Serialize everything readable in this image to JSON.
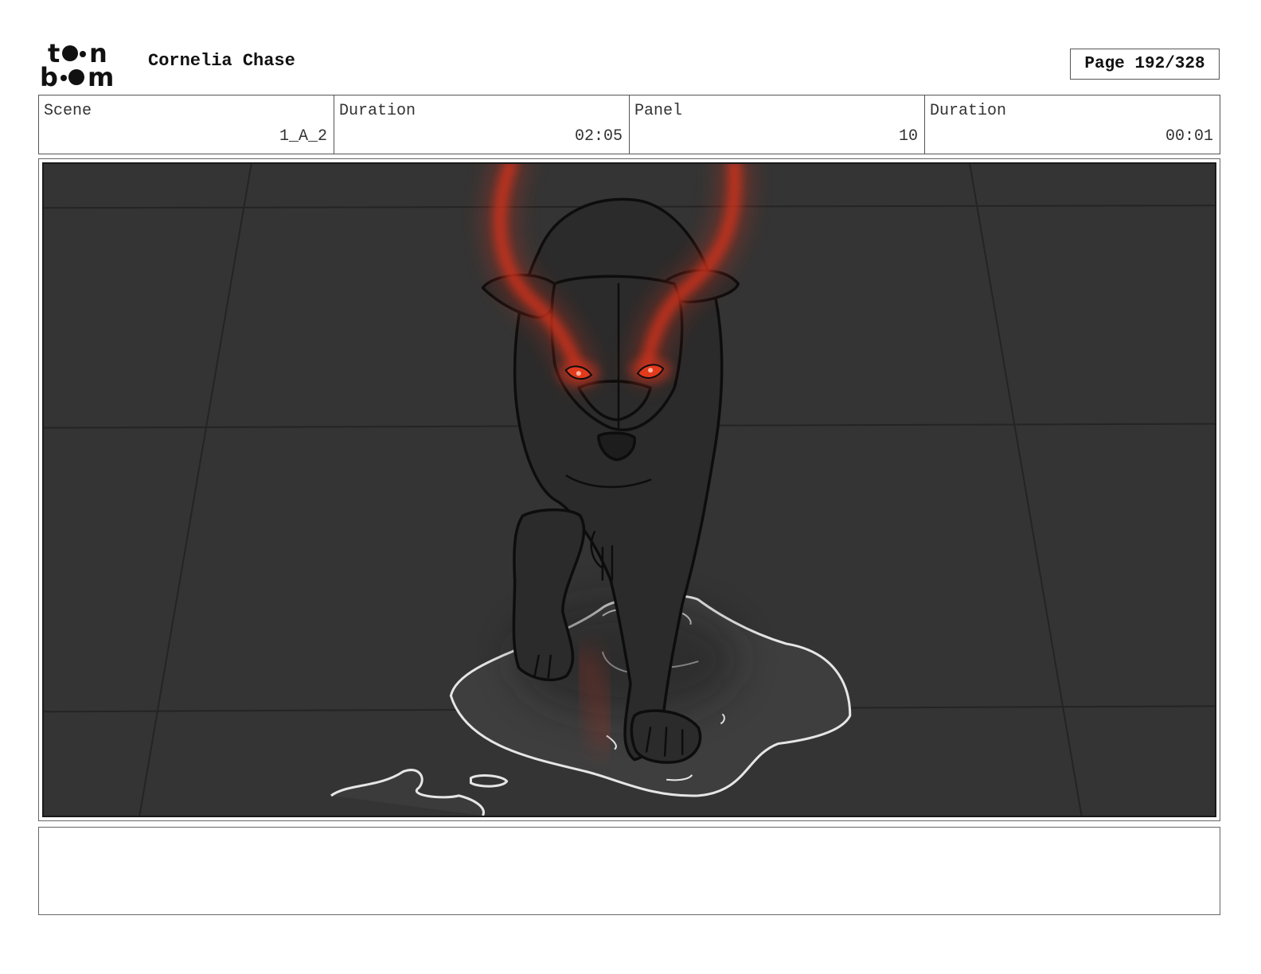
{
  "header": {
    "logo_text": "toon boom",
    "project_title": "Cornelia Chase",
    "page_label": "Page 192/328"
  },
  "info": {
    "scene_label": "Scene",
    "scene_value": "1_A_2",
    "scene_duration_label": "Duration",
    "scene_duration_value": "02:05",
    "panel_label": "Panel",
    "panel_value": "10",
    "panel_duration_label": "Duration",
    "panel_duration_value": "00:01"
  },
  "panel": {
    "description_icon": "glowing-eyed-dog-sketch",
    "colors": {
      "background": "#343434",
      "glow": "#d0331c",
      "puddle_line": "#e6e6e6"
    }
  },
  "notes": {
    "text": ""
  }
}
